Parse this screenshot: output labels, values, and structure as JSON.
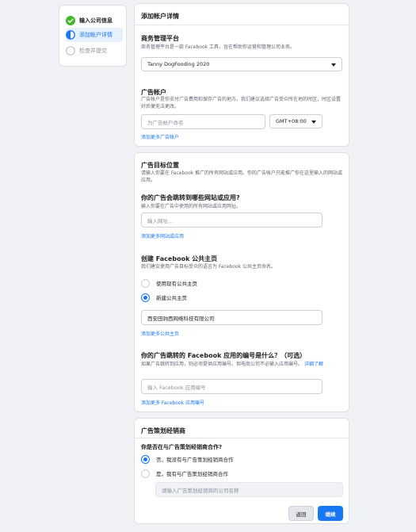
{
  "steps": [
    {
      "label": "输入公司信息",
      "state": "done",
      "icon": "check-circle-icon"
    },
    {
      "label": "添加帐户详情",
      "state": "current",
      "icon": "half-circle-icon"
    },
    {
      "label": "检查并提交",
      "state": "pending",
      "icon": "empty-circle-icon"
    }
  ],
  "account_details": {
    "title": "添加帐户详情",
    "business_manager": {
      "heading": "商务管理平台",
      "description": "商务管理平台是一款 Facebook 工具，旨在帮助你运营和管理公司业务。",
      "selected": "Tanny DogFooding 2020"
    },
    "ad_account": {
      "heading": "广告帐户",
      "description": "广告帐户是你支付广告费用和保存广告的地方。我们建议选择广告受众所在地的时区，时区设置好后便无法更改。",
      "name_placeholder": "为广告帐户命名",
      "timezone": "GMT+08:00",
      "add_more": "添加更多广告帐户"
    }
  },
  "ad_destination": {
    "title": "广告目标位置",
    "description": "请输入你要在 Facebook 推广的所有网站或应用。你的广告帐户只能推广你在这里输入的网站或应用。",
    "website": {
      "heading": "你的广告会跳转到哪些网站或应用?",
      "description": "输入你要在广告中使用的所有网站或应用网址。",
      "placeholder": "输入网址...",
      "add_more": "添加更多网站或应用"
    },
    "page": {
      "heading": "创建 Facebook 公共主页",
      "description": "我们建议使用广告目标受众的语言为 Facebook 公共主页命名。",
      "option_existing": "使用现有公共主页",
      "option_new": "新建公共主页",
      "page_name": "西安田驹西网络科技有限公司",
      "add_more": "添加更多公共主页"
    },
    "app": {
      "heading": "你的广告跳转的 Facebook 应用的编号是什么？（可选）",
      "description": "如果广告跳转到应用，则必须提供应用编号。但电商公司不必输入应用编号。",
      "learn_more": "详细了解",
      "placeholder": "输入 Facebook 应用编号",
      "add_more": "添加更多 Facebook 应用编号"
    }
  },
  "agency": {
    "title": "广告策划经销商",
    "question": "你是否在与广告策划经销商合作?",
    "option_no": "否，我没有与广告策划经销商合作",
    "option_yes": "是，我有与广告策划经销商合作",
    "agency_placeholder": "请输入广告策划经销商的公司名称"
  },
  "actions": {
    "back": "返回",
    "next": "继续"
  },
  "colors": {
    "accent": "#1877f2",
    "success": "#42b72a",
    "background": "#f0f2f5"
  }
}
